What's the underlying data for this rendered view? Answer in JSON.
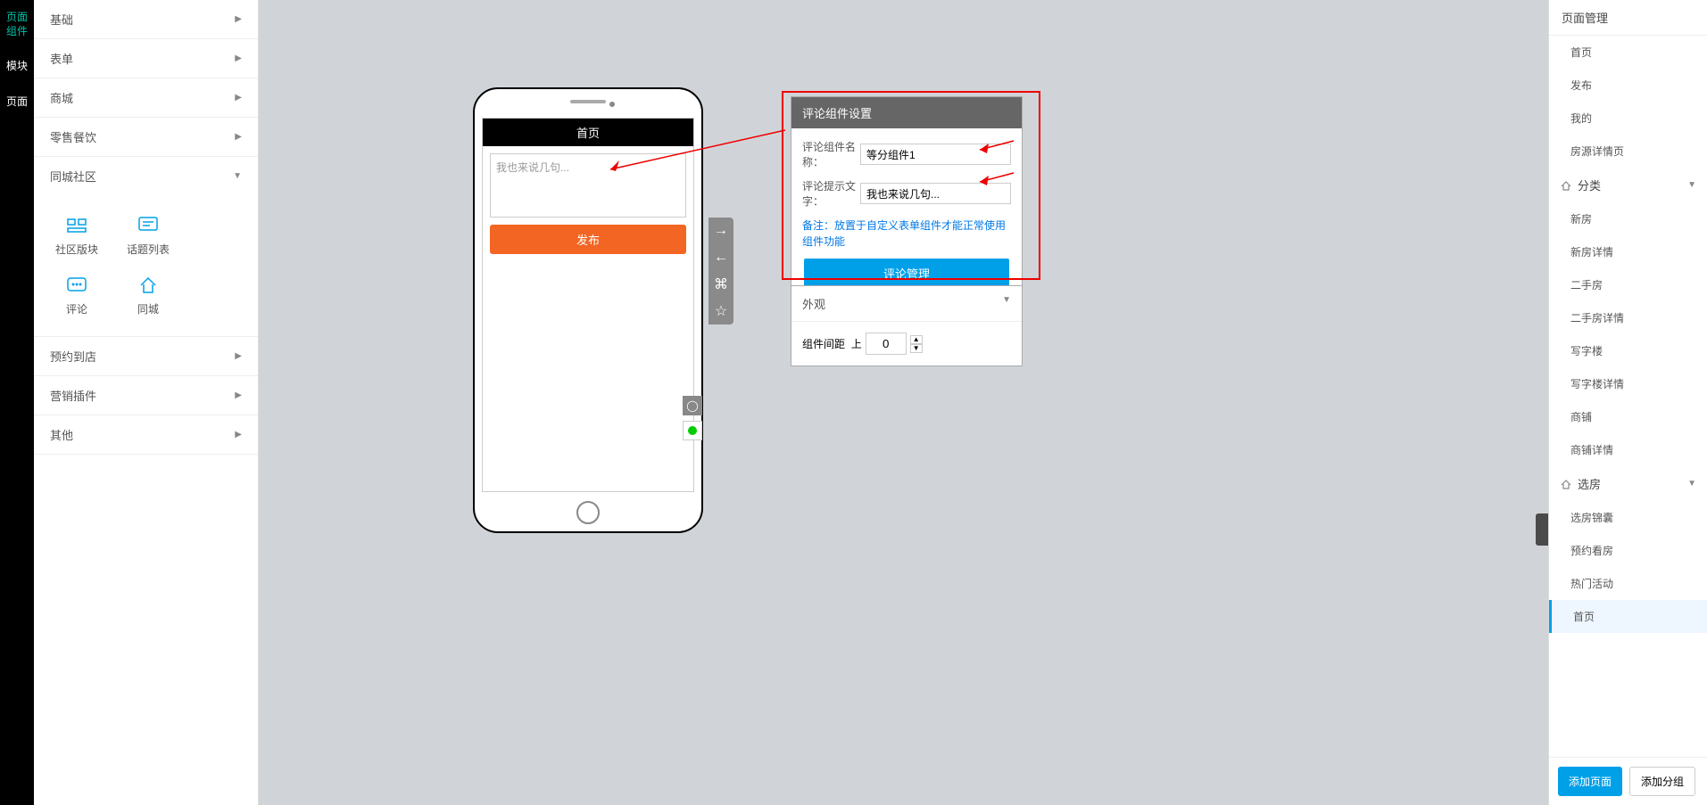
{
  "nav_strip": {
    "items": [
      {
        "label": "页面\n组件",
        "active": true
      },
      {
        "label": "模块",
        "active": false
      },
      {
        "label": "页面",
        "active": false
      }
    ]
  },
  "component_menu": {
    "groups": [
      {
        "label": "基础",
        "expanded": false
      },
      {
        "label": "表单",
        "expanded": false
      },
      {
        "label": "商城",
        "expanded": false
      },
      {
        "label": "零售餐饮",
        "expanded": false
      },
      {
        "label": "同城社区",
        "expanded": true,
        "items": [
          {
            "label": "社区版块",
            "icon": "block"
          },
          {
            "label": "话题列表",
            "icon": "list"
          },
          {
            "label": "评论",
            "icon": "comment"
          },
          {
            "label": "同城",
            "icon": "home"
          }
        ]
      },
      {
        "label": "预约到店",
        "expanded": false
      },
      {
        "label": "营销插件",
        "expanded": false
      },
      {
        "label": "其他",
        "expanded": false
      }
    ]
  },
  "phone": {
    "title": "首页",
    "comment_placeholder": "我也来说几句...",
    "publish": "发布"
  },
  "settings": {
    "title": "评论组件设置",
    "name_label": "评论组件名称：",
    "name_value": "等分组件1",
    "hint_label": "评论提示文字：",
    "hint_value": "我也来说几句...",
    "note": "备注：放置于自定义表单组件才能正常使用组件功能",
    "manage_btn": "评论管理"
  },
  "appearance": {
    "title": "外观",
    "spacing_label": "组件间距",
    "spacing_side": "上",
    "spacing_value": "0"
  },
  "page_manager": {
    "title": "页面管理",
    "root_items": [
      "首页",
      "发布",
      "我的",
      "房源详情页"
    ],
    "groups": [
      {
        "label": "分类",
        "items": [
          "新房",
          "新房详情",
          "二手房",
          "二手房详情",
          "写字楼",
          "写字楼详情",
          "商铺",
          "商铺详情"
        ]
      },
      {
        "label": "选房",
        "items": [
          "选房锦囊",
          "预约看房",
          "热门活动",
          "首页"
        ]
      }
    ],
    "active_item": "首页",
    "add_page": "添加页面",
    "add_group": "添加分组"
  }
}
